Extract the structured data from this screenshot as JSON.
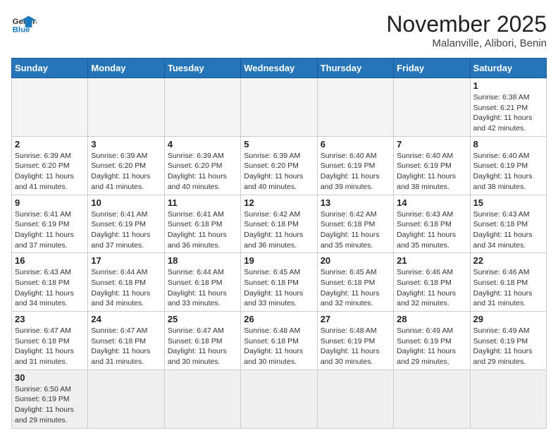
{
  "header": {
    "logo_general": "General",
    "logo_blue": "Blue",
    "title": "November 2025",
    "subtitle": "Malanville, Alibori, Benin"
  },
  "days_of_week": [
    "Sunday",
    "Monday",
    "Tuesday",
    "Wednesday",
    "Thursday",
    "Friday",
    "Saturday"
  ],
  "weeks": [
    [
      {
        "day": "",
        "info": ""
      },
      {
        "day": "",
        "info": ""
      },
      {
        "day": "",
        "info": ""
      },
      {
        "day": "",
        "info": ""
      },
      {
        "day": "",
        "info": ""
      },
      {
        "day": "",
        "info": ""
      },
      {
        "day": "1",
        "info": "Sunrise: 6:38 AM\nSunset: 6:21 PM\nDaylight: 11 hours and 42 minutes."
      }
    ],
    [
      {
        "day": "2",
        "info": "Sunrise: 6:39 AM\nSunset: 6:20 PM\nDaylight: 11 hours and 41 minutes."
      },
      {
        "day": "3",
        "info": "Sunrise: 6:39 AM\nSunset: 6:20 PM\nDaylight: 11 hours and 41 minutes."
      },
      {
        "day": "4",
        "info": "Sunrise: 6:39 AM\nSunset: 6:20 PM\nDaylight: 11 hours and 40 minutes."
      },
      {
        "day": "5",
        "info": "Sunrise: 6:39 AM\nSunset: 6:20 PM\nDaylight: 11 hours and 40 minutes."
      },
      {
        "day": "6",
        "info": "Sunrise: 6:40 AM\nSunset: 6:19 PM\nDaylight: 11 hours and 39 minutes."
      },
      {
        "day": "7",
        "info": "Sunrise: 6:40 AM\nSunset: 6:19 PM\nDaylight: 11 hours and 38 minutes."
      },
      {
        "day": "8",
        "info": "Sunrise: 6:40 AM\nSunset: 6:19 PM\nDaylight: 11 hours and 38 minutes."
      }
    ],
    [
      {
        "day": "9",
        "info": "Sunrise: 6:41 AM\nSunset: 6:19 PM\nDaylight: 11 hours and 37 minutes."
      },
      {
        "day": "10",
        "info": "Sunrise: 6:41 AM\nSunset: 6:19 PM\nDaylight: 11 hours and 37 minutes."
      },
      {
        "day": "11",
        "info": "Sunrise: 6:41 AM\nSunset: 6:18 PM\nDaylight: 11 hours and 36 minutes."
      },
      {
        "day": "12",
        "info": "Sunrise: 6:42 AM\nSunset: 6:18 PM\nDaylight: 11 hours and 36 minutes."
      },
      {
        "day": "13",
        "info": "Sunrise: 6:42 AM\nSunset: 6:18 PM\nDaylight: 11 hours and 35 minutes."
      },
      {
        "day": "14",
        "info": "Sunrise: 6:43 AM\nSunset: 6:18 PM\nDaylight: 11 hours and 35 minutes."
      },
      {
        "day": "15",
        "info": "Sunrise: 6:43 AM\nSunset: 6:18 PM\nDaylight: 11 hours and 34 minutes."
      }
    ],
    [
      {
        "day": "16",
        "info": "Sunrise: 6:43 AM\nSunset: 6:18 PM\nDaylight: 11 hours and 34 minutes."
      },
      {
        "day": "17",
        "info": "Sunrise: 6:44 AM\nSunset: 6:18 PM\nDaylight: 11 hours and 34 minutes."
      },
      {
        "day": "18",
        "info": "Sunrise: 6:44 AM\nSunset: 6:18 PM\nDaylight: 11 hours and 33 minutes."
      },
      {
        "day": "19",
        "info": "Sunrise: 6:45 AM\nSunset: 6:18 PM\nDaylight: 11 hours and 33 minutes."
      },
      {
        "day": "20",
        "info": "Sunrise: 6:45 AM\nSunset: 6:18 PM\nDaylight: 11 hours and 32 minutes."
      },
      {
        "day": "21",
        "info": "Sunrise: 6:46 AM\nSunset: 6:18 PM\nDaylight: 11 hours and 32 minutes."
      },
      {
        "day": "22",
        "info": "Sunrise: 6:46 AM\nSunset: 6:18 PM\nDaylight: 11 hours and 31 minutes."
      }
    ],
    [
      {
        "day": "23",
        "info": "Sunrise: 6:47 AM\nSunset: 6:18 PM\nDaylight: 11 hours and 31 minutes."
      },
      {
        "day": "24",
        "info": "Sunrise: 6:47 AM\nSunset: 6:18 PM\nDaylight: 11 hours and 31 minutes."
      },
      {
        "day": "25",
        "info": "Sunrise: 6:47 AM\nSunset: 6:18 PM\nDaylight: 11 hours and 30 minutes."
      },
      {
        "day": "26",
        "info": "Sunrise: 6:48 AM\nSunset: 6:18 PM\nDaylight: 11 hours and 30 minutes."
      },
      {
        "day": "27",
        "info": "Sunrise: 6:48 AM\nSunset: 6:19 PM\nDaylight: 11 hours and 30 minutes."
      },
      {
        "day": "28",
        "info": "Sunrise: 6:49 AM\nSunset: 6:19 PM\nDaylight: 11 hours and 29 minutes."
      },
      {
        "day": "29",
        "info": "Sunrise: 6:49 AM\nSunset: 6:19 PM\nDaylight: 11 hours and 29 minutes."
      }
    ],
    [
      {
        "day": "30",
        "info": "Sunrise: 6:50 AM\nSunset: 6:19 PM\nDaylight: 11 hours and 29 minutes."
      },
      {
        "day": "",
        "info": ""
      },
      {
        "day": "",
        "info": ""
      },
      {
        "day": "",
        "info": ""
      },
      {
        "day": "",
        "info": ""
      },
      {
        "day": "",
        "info": ""
      },
      {
        "day": "",
        "info": ""
      }
    ]
  ]
}
